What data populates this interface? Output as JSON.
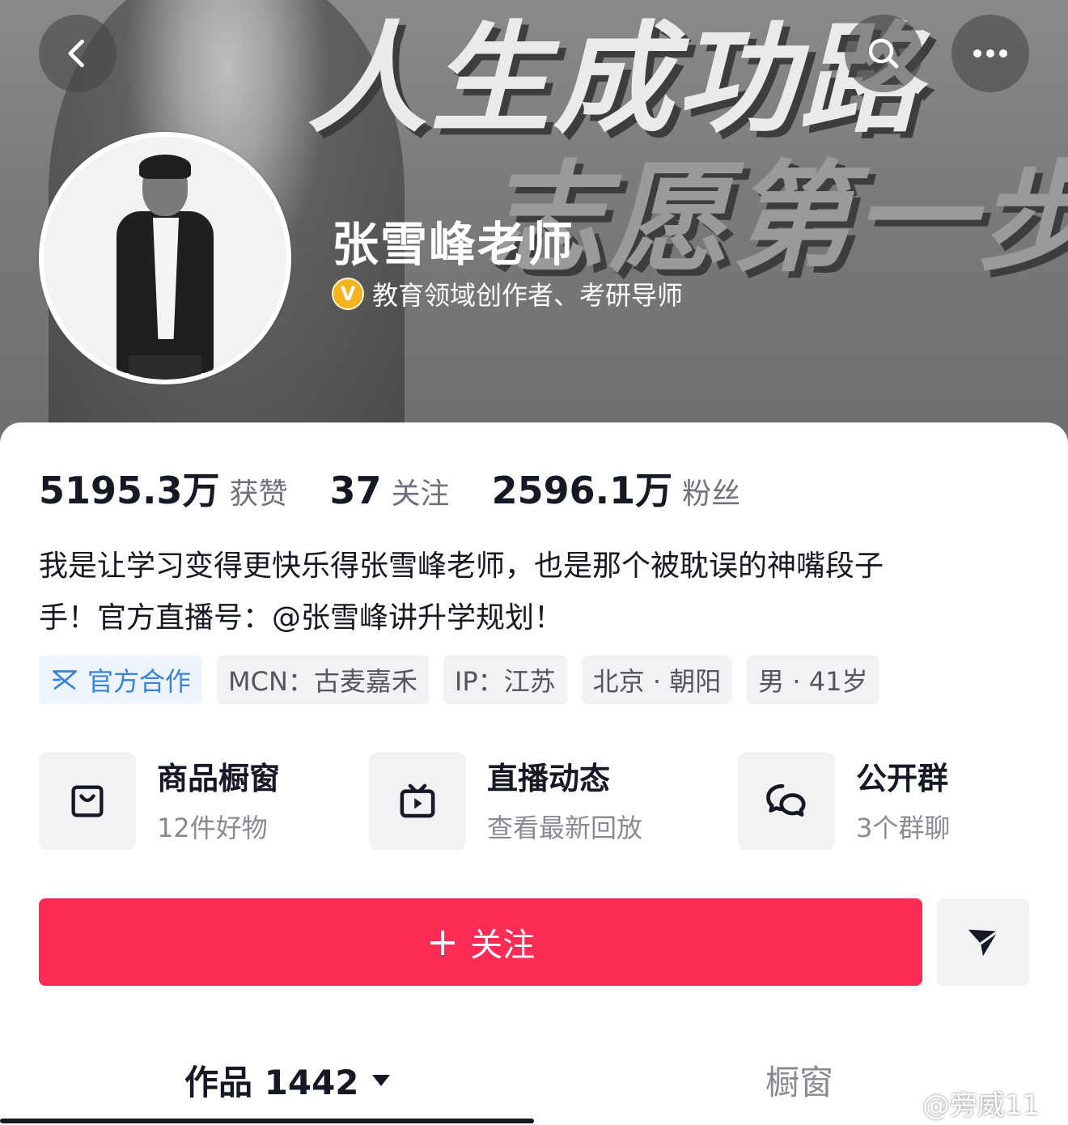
{
  "header": {
    "banner_line1": "人生成功路",
    "banner_line2": "志愿第一步",
    "back_icon": "chevron-left-icon",
    "search_icon": "search-icon",
    "more_icon": "more-horizontal-icon"
  },
  "profile": {
    "name": "张雪峰老师",
    "verify_badge": "V",
    "verify_text": "教育领域创作者、考研导师"
  },
  "stats": [
    {
      "value": "5195.3万",
      "label": "获赞"
    },
    {
      "value": "37",
      "label": "关注"
    },
    {
      "value": "2596.1万",
      "label": "粉丝"
    }
  ],
  "bio": {
    "line1": "我是让学习变得更快乐得张雪峰老师，也是那个被耽误的神嘴段子",
    "line2": "手！官方直播号：@张雪峰讲升学规划！"
  },
  "tags": [
    {
      "label": "官方合作",
      "accent": "#3a82d8"
    },
    {
      "label": "MCN：古麦嘉禾"
    },
    {
      "label": "IP：江苏"
    },
    {
      "label": "北京 · 朝阳"
    },
    {
      "label": "男 · 41岁"
    }
  ],
  "services": [
    {
      "title": "商品橱窗",
      "subtitle": "12件好物",
      "icon": "shopping-bag-icon"
    },
    {
      "title": "直播动态",
      "subtitle": "查看最新回放",
      "icon": "tv-play-icon"
    },
    {
      "title": "公开群",
      "subtitle": "3个群聊",
      "icon": "chat-bubbles-icon"
    }
  ],
  "actions": {
    "follow_plus": "+",
    "follow_label": "关注",
    "follow_color": "#fe2c55",
    "share_icon": "send-arrow-icon"
  },
  "tabs": {
    "works_label": "作品 1442",
    "shop_label": "橱窗"
  },
  "watermark": "@旁威11"
}
